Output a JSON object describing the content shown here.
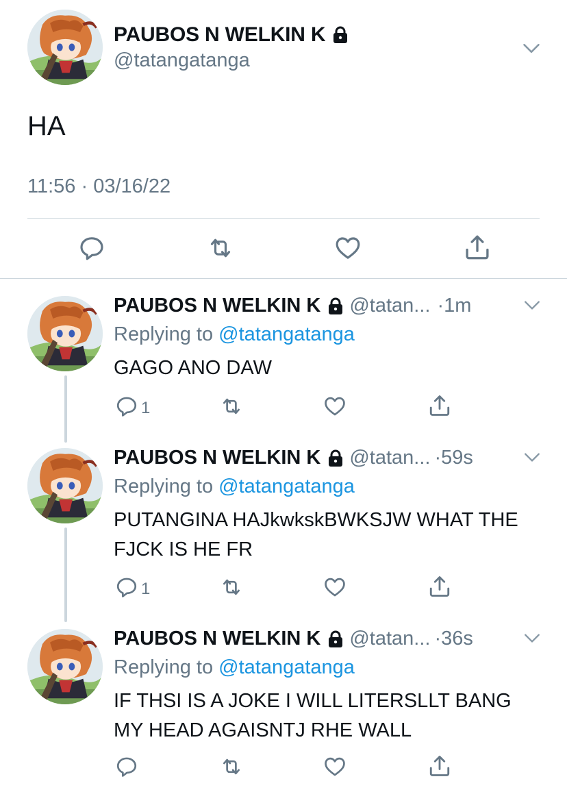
{
  "main_tweet": {
    "display_name": "PAUBOS N WELKIN K",
    "handle": "@tatangatanga",
    "text": "HA",
    "timestamp": "11:56 · 03/16/22"
  },
  "icons": {
    "lock": "lock-icon",
    "menu": "chevron-down-icon",
    "reply": "reply-icon",
    "retweet": "retweet-icon",
    "like": "heart-icon",
    "share": "share-icon"
  },
  "colors": {
    "text": "#0f1419",
    "muted": "#657786",
    "link": "#1b95e0",
    "divider": "#ccd6dd"
  },
  "replies": [
    {
      "display_name": "PAUBOS N WELKIN K",
      "handle": "@tatan...",
      "time": "1m",
      "replying_prefix": "Replying to",
      "replying_to": "@tatangatanga",
      "text": "GAGO ANO DAW",
      "reply_count": "1"
    },
    {
      "display_name": "PAUBOS N WELKIN K",
      "handle": "@tatan...",
      "time": "59s",
      "replying_prefix": "Replying to",
      "replying_to": "@tatangatanga",
      "text": "PUTANGINA HAJkwkskBWKSJW WHAT THE FJCK IS HE FR",
      "reply_count": "1"
    },
    {
      "display_name": "PAUBOS N WELKIN K",
      "handle": "@tatan...",
      "time": "36s",
      "replying_prefix": "Replying to",
      "replying_to": "@tatangatanga",
      "text": "IF THSI IS A JOKE I WILL LITERSLLT BANG MY HEAD AGAISNTJ RHE WALL",
      "reply_count": ""
    }
  ]
}
